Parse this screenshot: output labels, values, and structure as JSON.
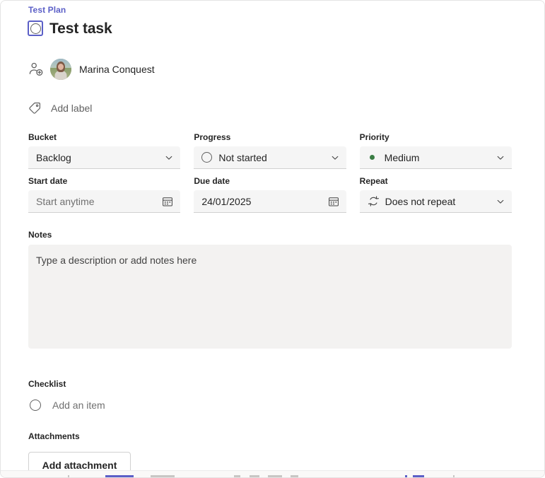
{
  "breadcrumb": {
    "plan_name": "Test Plan"
  },
  "task": {
    "title": "Test task",
    "checkbox_icon": "circle-checkbox-icon",
    "completed": false
  },
  "assignee": {
    "add_icon": "add-person-icon",
    "name": "Marina Conquest"
  },
  "labels": {
    "icon": "tag-icon",
    "add_label_text": "Add label"
  },
  "fields": {
    "bucket": {
      "label": "Bucket",
      "value": "Backlog",
      "chevron_icon": "chevron-down-icon"
    },
    "progress": {
      "label": "Progress",
      "value": "Not started",
      "status_icon": "not-started-circle-icon",
      "chevron_icon": "chevron-down-icon"
    },
    "priority": {
      "label": "Priority",
      "value": "Medium",
      "dot_color": "#3a7d44",
      "chevron_icon": "chevron-down-icon"
    },
    "start_date": {
      "label": "Start date",
      "value": "",
      "placeholder": "Start anytime",
      "calendar_icon": "calendar-icon"
    },
    "due_date": {
      "label": "Due date",
      "value": "24/01/2025",
      "calendar_icon": "calendar-icon"
    },
    "repeat": {
      "label": "Repeat",
      "value": "Does not repeat",
      "repeat_icon": "repeat-icon",
      "chevron_icon": "chevron-down-icon"
    }
  },
  "notes": {
    "label": "Notes",
    "value": "",
    "placeholder": "Type a description or add notes here"
  },
  "checklist": {
    "label": "Checklist",
    "add_item_placeholder": "Add an item",
    "circle_icon": "checklist-circle-icon",
    "items": []
  },
  "attachments": {
    "label": "Attachments",
    "add_button_label": "Add attachment",
    "items": []
  },
  "theme": {
    "accent": "#5b5fc7",
    "text_primary": "#242424",
    "text_secondary": "#616161",
    "text_placeholder": "#707070",
    "field_bg": "#f5f5f5",
    "notes_bg": "#f3f2f1",
    "priority_medium": "#3a7d44"
  }
}
